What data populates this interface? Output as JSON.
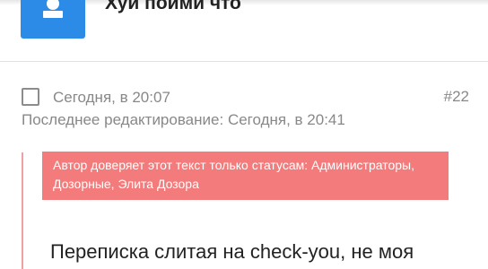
{
  "author": {
    "name": "Хуй пойми что",
    "avatar_icon": "user-silhouette-icon",
    "avatar_color": "#2b8be6"
  },
  "post": {
    "date": "Сегодня, в 20:07",
    "number": "#22",
    "edited_label": "Последнее редактирование:",
    "edited_date": "Сегодня, в 20:41",
    "restriction": {
      "line1": "Автор доверяет этот текст только статусам: Администраторы,",
      "line2": "Дозорные, Элита Дозора",
      "color": "#f47b7b"
    },
    "title": "Переписка слитая на check-you, не моя"
  }
}
